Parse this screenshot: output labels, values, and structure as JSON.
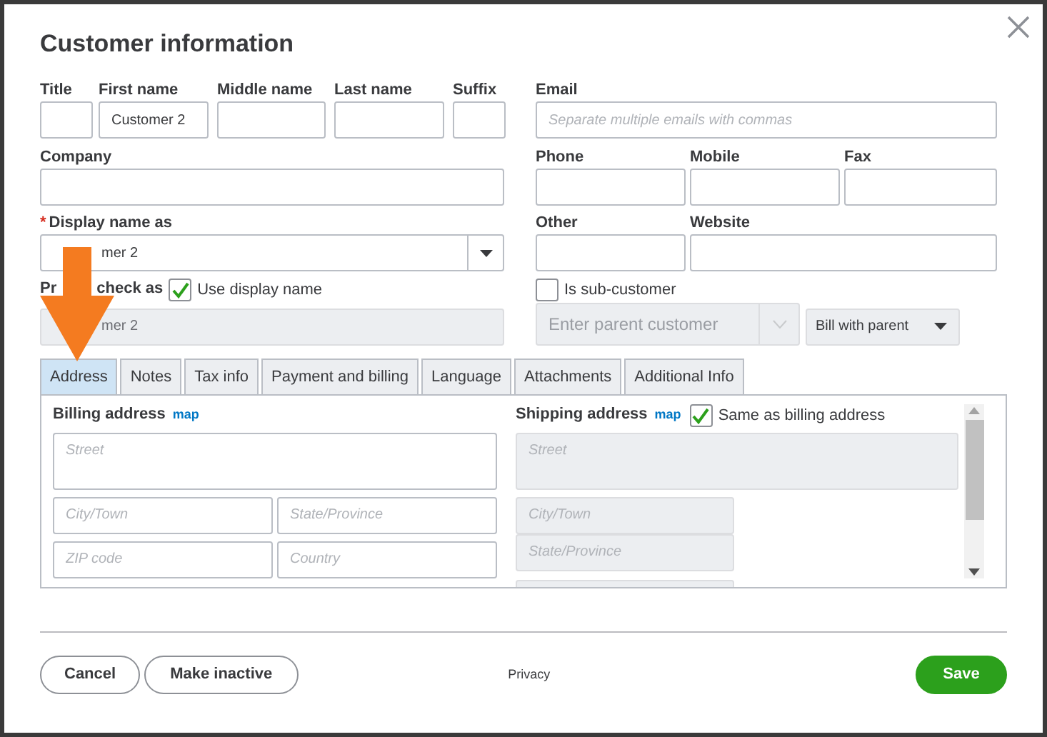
{
  "dialog": {
    "title": "Customer information"
  },
  "name_fields": [
    {
      "label": "Title"
    },
    {
      "label": "First name",
      "value": "Customer 2"
    },
    {
      "label": "Middle name"
    },
    {
      "label": "Last name"
    },
    {
      "label": "Suffix"
    }
  ],
  "email": {
    "label": "Email",
    "placeholder": "Separate multiple emails with commas"
  },
  "company": {
    "label": "Company"
  },
  "phones": [
    {
      "label": "Phone"
    },
    {
      "label": "Mobile"
    },
    {
      "label": "Fax"
    }
  ],
  "display_name": {
    "required_mark": "*",
    "label": "Display name as",
    "value": "mer 2"
  },
  "contact2": [
    {
      "label": "Other"
    },
    {
      "label": "Website"
    }
  ],
  "print_on_check": {
    "label_start": "Pr",
    "label_end": "check as",
    "option": "Use display name",
    "checked": true,
    "value": "mer 2",
    "disabled": true
  },
  "sub_customer": {
    "label": "Is sub-customer",
    "checked": false,
    "parent_placeholder": "Enter parent customer",
    "bill_option": "Bill with parent"
  },
  "tabs": [
    {
      "label": "Address",
      "selected": true
    },
    {
      "label": "Notes",
      "selected": false
    },
    {
      "label": "Tax info",
      "selected": false
    },
    {
      "label": "Payment and billing",
      "selected": false
    },
    {
      "label": "Language",
      "selected": false
    },
    {
      "label": "Attachments",
      "selected": false
    },
    {
      "label": "Additional Info",
      "selected": false
    }
  ],
  "billing": {
    "title": "Billing address",
    "map_link": "map",
    "street_placeholder": "Street",
    "city_placeholder": "City/Town",
    "state_placeholder": "State/Province",
    "zip_placeholder": "ZIP code",
    "country_placeholder": "Country"
  },
  "shipping": {
    "title": "Shipping address",
    "map_link": "map",
    "same_label": "Same as billing address",
    "same_checked": true,
    "street_placeholder": "Street",
    "city_placeholder": "City/Town",
    "state_placeholder": "State/Province"
  },
  "footer": {
    "cancel": "Cancel",
    "inactive": "Make inactive",
    "privacy": "Privacy",
    "save": "Save"
  }
}
